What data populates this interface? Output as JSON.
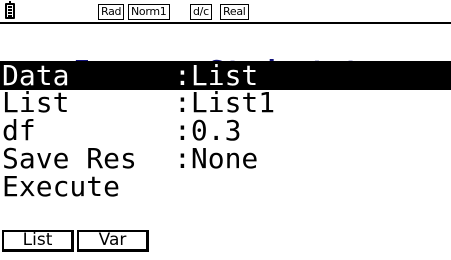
{
  "status_bar": {
    "battery_icon": "battery-icon",
    "angle_mode": "Rad",
    "display_mode": "Norm1",
    "fraction_mode": "d/c",
    "complex_mode": "Real"
  },
  "screen": {
    "title": "Inverse Student-t",
    "rows": [
      {
        "name": "Data",
        "value": ":List",
        "selected": true
      },
      {
        "name": "List",
        "value": ":List1",
        "selected": false
      },
      {
        "name": "df",
        "value": ":0.3",
        "selected": false
      },
      {
        "name": "Save Res",
        "value": ":None",
        "selected": false
      },
      {
        "name": "Execute",
        "value": "",
        "selected": false
      }
    ]
  },
  "function_keys": [
    {
      "label": "List"
    },
    {
      "label": "Var"
    }
  ],
  "colors": {
    "title": "#12127a",
    "highlight_bg": "#000000",
    "highlight_fg": "#ffffff",
    "text": "#000000",
    "background": "#ffffff"
  }
}
